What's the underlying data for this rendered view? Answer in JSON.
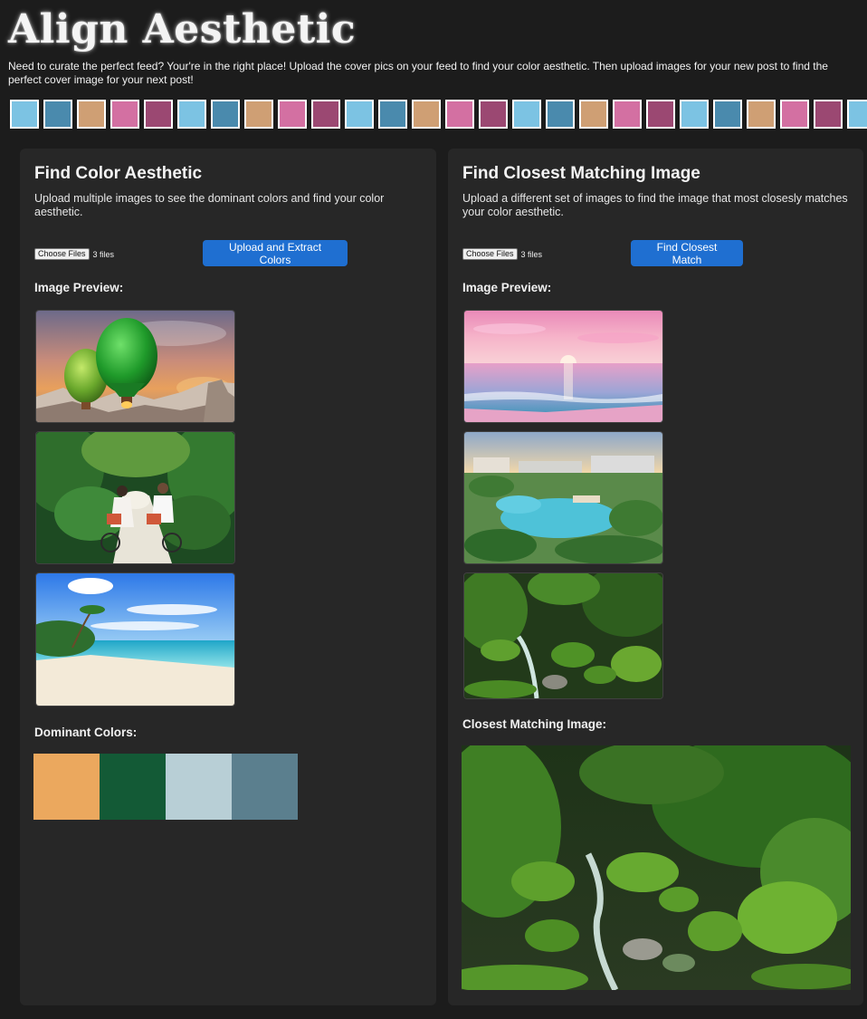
{
  "header": {
    "title": "Align Aesthetic",
    "intro": "Need to curate the perfect feed? Your're in the right place! Upload the cover pics on your feed to find your color aesthetic. Then upload images for your new post to find the perfect cover image for your next post!"
  },
  "swatch_strip": {
    "colors": [
      "#7cc3e3",
      "#4a8aad",
      "#cf9f74",
      "#d370a2",
      "#9b4872",
      "#7cc3e3",
      "#4a8aad",
      "#cf9f74",
      "#d370a2",
      "#9b4872",
      "#7cc3e3",
      "#4a8aad",
      "#cf9f74",
      "#d370a2",
      "#9b4872",
      "#7cc3e3",
      "#4a8aad",
      "#cf9f74",
      "#d370a2",
      "#9b4872",
      "#7cc3e3",
      "#4a8aad",
      "#cf9f74",
      "#d370a2",
      "#9b4872",
      "#7cc3e3",
      "#4a8aad"
    ]
  },
  "aesthetic_panel": {
    "heading": "Find Color Aesthetic",
    "description": "Upload multiple images to see the dominant colors and find your color aesthetic.",
    "choose_files_label": "Choose Files",
    "file_status": "3 files",
    "upload_button_label": "Upload and Extract Colors",
    "preview_label": "Image Preview:",
    "dominant_label": "Dominant Colors:",
    "dominant_colors": [
      "#eba85e",
      "#135a36",
      "#b8cfd6",
      "#5b7f8e"
    ]
  },
  "match_panel": {
    "heading": "Find Closest Matching Image",
    "description": "Upload a different set of images to find the image that most closesly matches your color aesthetic.",
    "choose_files_label": "Choose Files",
    "file_status": "3 files",
    "match_button_label": "Find Closest Match",
    "preview_label": "Image Preview:",
    "result_label": "Closest Matching Image:"
  }
}
